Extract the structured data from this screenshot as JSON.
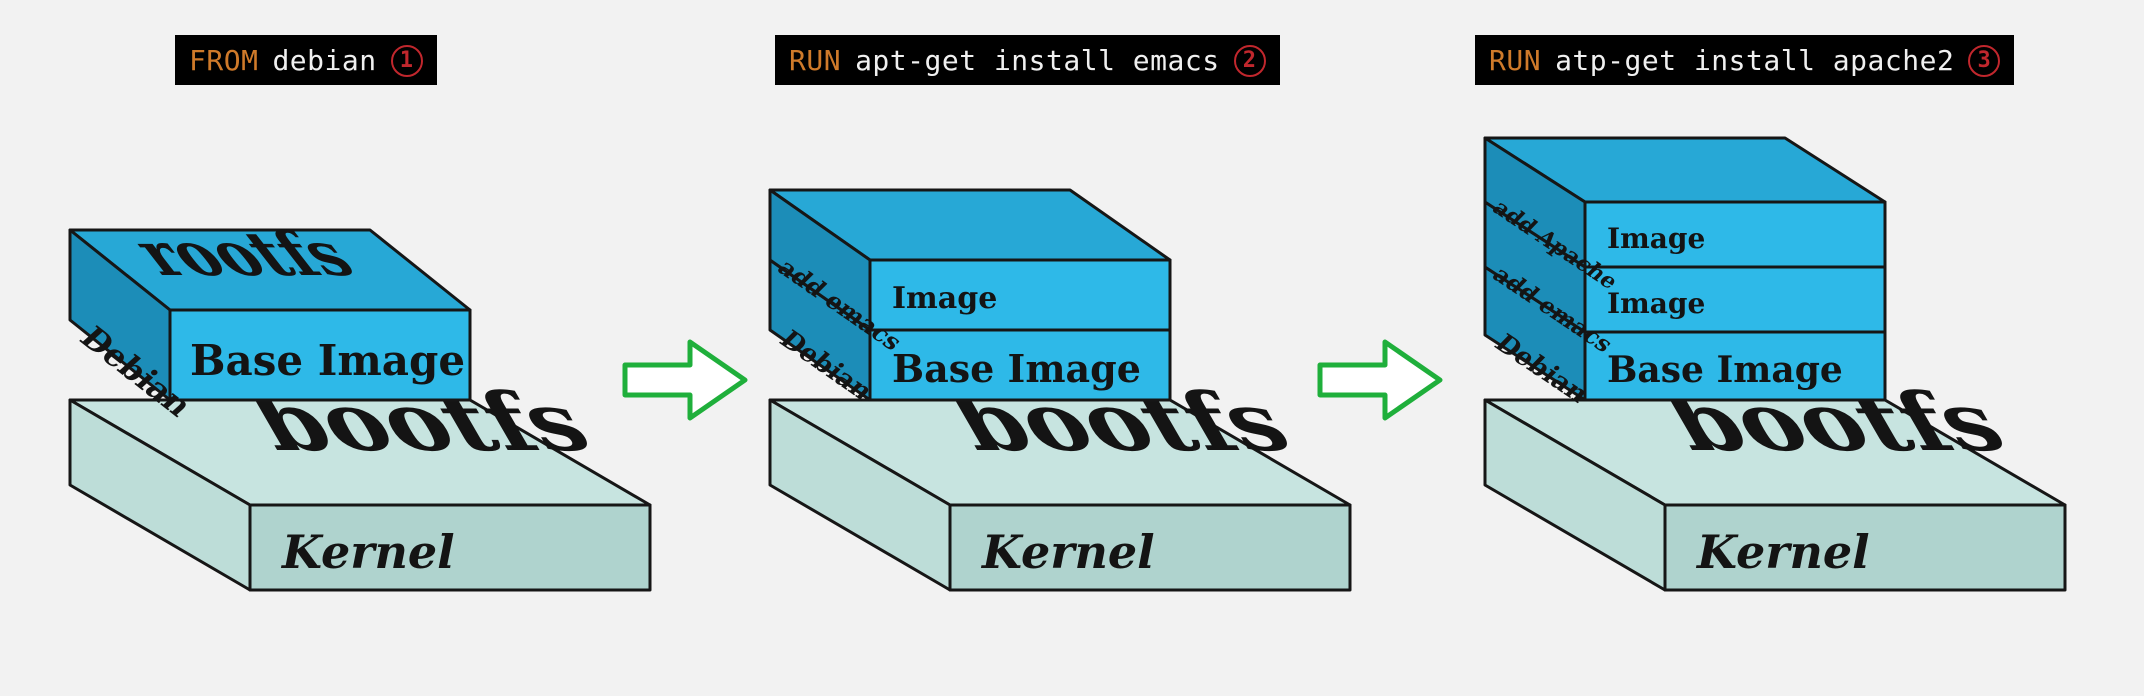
{
  "commands": [
    {
      "keyword": "FROM",
      "rest": "debian",
      "num": "1"
    },
    {
      "keyword": "RUN",
      "rest": "apt-get install emacs",
      "num": "2"
    },
    {
      "keyword": "RUN",
      "rest": "atp-get install apache2",
      "num": "3"
    }
  ],
  "kernel": {
    "top_label": "bootfs",
    "front_label": "Kernel"
  },
  "panels": [
    {
      "boxes": [
        {
          "side": "Debian",
          "front": "Base Image",
          "top": "rootfs"
        }
      ]
    },
    {
      "boxes": [
        {
          "side": "Debian",
          "front": "Base Image",
          "top": ""
        },
        {
          "side": "add emacs",
          "front": "Image",
          "top": ""
        }
      ]
    },
    {
      "boxes": [
        {
          "side": "Debian",
          "front": "Base Image",
          "top": ""
        },
        {
          "side": "add emacs",
          "front": "Image",
          "top": ""
        },
        {
          "side": "add Apache",
          "front": "Image",
          "top": ""
        }
      ]
    }
  ]
}
